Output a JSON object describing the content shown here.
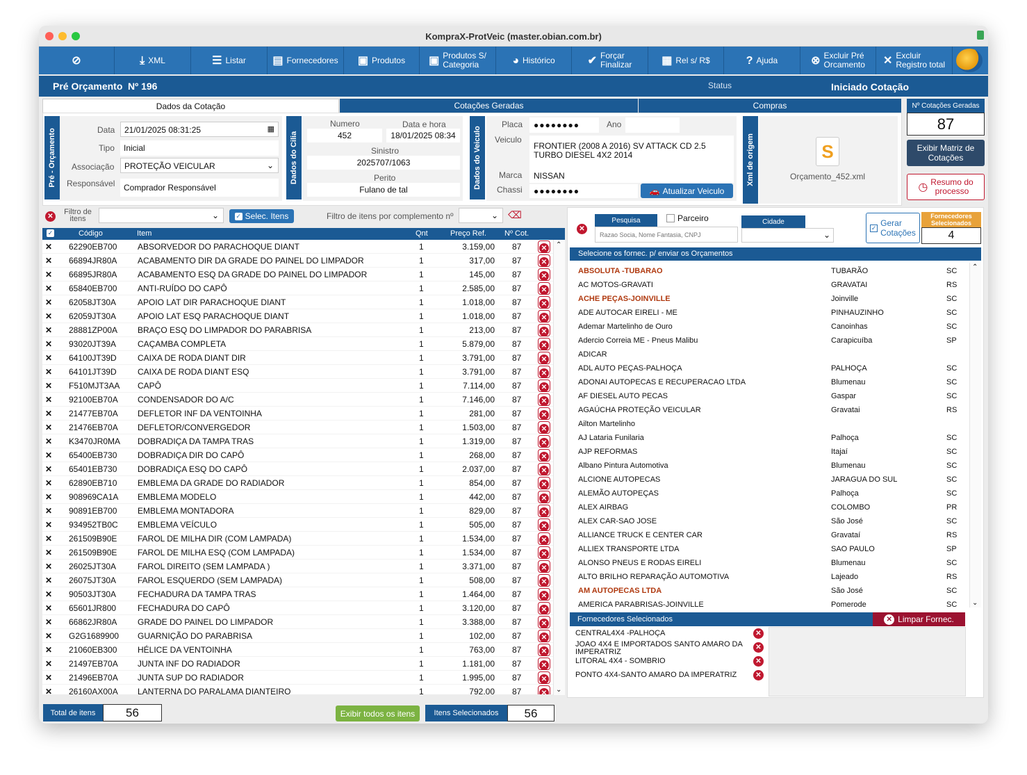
{
  "window": {
    "title": "KompraX-ProtVeic (master.obian.com.br)"
  },
  "toolbar": {
    "xml": "XML",
    "listar": "Listar",
    "fornecedores": "Fornecedores",
    "produtos": "Produtos",
    "produtos_cat_1": "Produtos S/",
    "produtos_cat_2": "Categoria",
    "historico": "Histórico",
    "forcar_1": "Forçar",
    "forcar_2": "Finalizar",
    "rel": "Rel s/ R$",
    "ajuda": "Ajuda",
    "excluir_pre_1": "Excluir Pré",
    "excluir_pre_2": "Orcamento",
    "excluir_reg_1": "Excluir",
    "excluir_reg_2": "Registro total"
  },
  "header": {
    "title": "Pré Orçamento",
    "number": "Nº 196",
    "status_label": "Status",
    "status_value": "Iniciado Cotação"
  },
  "tabs": {
    "dados": "Dados da Cotação",
    "cotacoes": "Cotações Geradas",
    "compras": "Compras"
  },
  "pre_orcamento": {
    "side": "Pré - Orçamento",
    "data_label": "Data",
    "data": "21/01/2025 08:31:25",
    "tipo_label": "Tipo",
    "tipo": "Inicial",
    "assoc_label": "Associação",
    "assoc": "PROTEÇÃO VEICULAR",
    "resp_label": "Responsável",
    "resp": "Comprador Responsável"
  },
  "cilia": {
    "side": "Dados do Cilia",
    "numero_label": "Numero",
    "numero": "452",
    "datahora_label": "Data e hora",
    "datahora": "18/01/2025 08:34",
    "sinistro_label": "Sinistro",
    "sinistro": "2025707/1063",
    "perito_label": "Perito",
    "perito": "Fulano de tal"
  },
  "veiculo": {
    "side": "Dados do Veiculo",
    "placa_label": "Placa",
    "placa": "●●●●●●●●",
    "ano_label": "Ano",
    "veiculo_label": "Veiculo",
    "veiculo_1": "FRONTIER (2008 A 2016) SV ATTACK CD 2.5",
    "veiculo_2": "TURBO DIESEL 4X2 2014",
    "marca_label": "Marca",
    "marca": "NISSAN",
    "chassi_label": "Chassi",
    "chassi": "●●●●●●●●",
    "atualizar": "Atualizar Veiculo"
  },
  "xml": {
    "side": "Xml de origem",
    "file": "Orçamento_452.xml"
  },
  "cotacoes": {
    "label": "Nº  Cotações Geradas",
    "count": "87",
    "matriz_1": "Exibir Matriz de",
    "matriz_2": "Cotações",
    "resumo_1": "Resumo do",
    "resumo_2": "processo"
  },
  "filter": {
    "filtro_1": "Filtro de",
    "filtro_2": "itens",
    "selec": "Selec. Itens",
    "complemento": "Filtro de itens por complemento nº"
  },
  "items_header": {
    "codigo": "Código",
    "item": "Item",
    "qnt": "Qnt",
    "preco": "Preço Ref.",
    "ncot": "Nº Cot."
  },
  "items": [
    [
      "62290EB700",
      "ABSORVEDOR DO PARACHOQUE DIANT",
      "1",
      "3.159,00",
      "87"
    ],
    [
      "66894JR80A",
      "ACABAMENTO DIR DA GRADE DO PAINEL DO LIMPADOR",
      "1",
      "317,00",
      "87"
    ],
    [
      "66895JR80A",
      "ACABAMENTO ESQ DA GRADE DO PAINEL DO LIMPADOR",
      "1",
      "145,00",
      "87"
    ],
    [
      "65840EB700",
      "ANTI-RUÍDO DO CAPÔ",
      "1",
      "2.585,00",
      "87"
    ],
    [
      "62058JT30A",
      "APOIO LAT DIR PARACHOQUE DIANT",
      "1",
      "1.018,00",
      "87"
    ],
    [
      "62059JT30A",
      "APOIO LAT ESQ PARACHOQUE DIANT",
      "1",
      "1.018,00",
      "87"
    ],
    [
      "28881ZP00A",
      "BRAÇO ESQ DO LIMPADOR DO PARABRISA",
      "1",
      "213,00",
      "87"
    ],
    [
      "93020JT39A",
      "CAÇAMBA COMPLETA",
      "1",
      "5.879,00",
      "87"
    ],
    [
      "64100JT39D",
      "CAIXA DE RODA DIANT DIR",
      "1",
      "3.791,00",
      "87"
    ],
    [
      "64101JT39D",
      "CAIXA DE RODA DIANT ESQ",
      "1",
      "3.791,00",
      "87"
    ],
    [
      "F510MJT3AA",
      "CAPÔ",
      "1",
      "7.114,00",
      "87"
    ],
    [
      "92100EB70A",
      "CONDENSADOR DO A/C",
      "1",
      "7.146,00",
      "87"
    ],
    [
      "21477EB70A",
      "DEFLETOR INF DA VENTOINHA",
      "1",
      "281,00",
      "87"
    ],
    [
      "21476EB70A",
      "DEFLETOR/CONVERGEDOR",
      "1",
      "1.503,00",
      "87"
    ],
    [
      "K3470JR0MA",
      "DOBRADIÇA DA TAMPA TRAS",
      "1",
      "1.319,00",
      "87"
    ],
    [
      "65400EB730",
      "DOBRADIÇA DIR DO CAPÔ",
      "1",
      "268,00",
      "87"
    ],
    [
      "65401EB730",
      "DOBRADIÇA ESQ DO CAPÔ",
      "1",
      "2.037,00",
      "87"
    ],
    [
      "62890EB710",
      "EMBLEMA DA GRADE DO RADIADOR",
      "1",
      "854,00",
      "87"
    ],
    [
      "908969CA1A",
      "EMBLEMA MODELO",
      "1",
      "442,00",
      "87"
    ],
    [
      "90891EB700",
      "EMBLEMA MONTADORA",
      "1",
      "829,00",
      "87"
    ],
    [
      "934952TB0C",
      "EMBLEMA VEÍCULO",
      "1",
      "505,00",
      "87"
    ],
    [
      "261509B90E",
      "FAROL DE MILHA DIR (COM LAMPADA)",
      "1",
      "1.534,00",
      "87"
    ],
    [
      "261509B90E",
      "FAROL DE MILHA ESQ (COM LAMPADA)",
      "1",
      "1.534,00",
      "87"
    ],
    [
      "26025JT30A",
      "FAROL DIREITO (SEM LAMPADA )",
      "1",
      "3.371,00",
      "87"
    ],
    [
      "26075JT30A",
      "FAROL ESQUERDO (SEM LAMPADA)",
      "1",
      "508,00",
      "87"
    ],
    [
      "90503JT30A",
      "FECHADURA DA TAMPA TRAS",
      "1",
      "1.464,00",
      "87"
    ],
    [
      "65601JR800",
      "FECHADURA DO CAPÔ",
      "1",
      "3.120,00",
      "87"
    ],
    [
      "66862JR80A",
      "GRADE DO PAINEL DO LIMPADOR",
      "1",
      "3.388,00",
      "87"
    ],
    [
      "G2G1689900",
      "GUARNIÇÃO DO PARABRISA",
      "1",
      "102,00",
      "87"
    ],
    [
      "21060EB300",
      "HÉLICE DA VENTOINHA",
      "1",
      "763,00",
      "87"
    ],
    [
      "21497EB70A",
      "JUNTA INF DO RADIADOR",
      "1",
      "1.181,00",
      "87"
    ],
    [
      "21496EB70A",
      "JUNTA SUP DO RADIADOR",
      "1",
      "1.995,00",
      "87"
    ],
    [
      "26160AX00A",
      "LANTERNA DO PARALAMA DIANTEIRO",
      "1",
      "792,00",
      "87"
    ]
  ],
  "footer": {
    "total_label": "Total de itens",
    "total": "56",
    "exibir": "Exibir todos os itens",
    "sel_label": "Itens Selecionados",
    "sel": "56"
  },
  "suppliers": {
    "pesquisa": "Pesquisa",
    "parceiro": "Parceiro",
    "placeholder": "Razao Socia, Nome Fantasia, CNPJ",
    "cidade": "Cidade",
    "gerar_1": "Gerar",
    "gerar_2": "Cotações",
    "selecionados_label": "Fornecedores Selecionados",
    "selecionados": "4",
    "list_title": "Selecione os fornec. p/ enviar os Orçamentos",
    "list": [
      [
        "ABSOLUTA -TUBARAO",
        "TUBARÃO",
        "SC",
        true
      ],
      [
        "AC MOTOS-GRAVATI",
        "GRAVATAI",
        "RS",
        false
      ],
      [
        "ACHE PEÇAS-JOINVILLE",
        "Joinville",
        "SC",
        true
      ],
      [
        "ADE AUTOCAR EIRELI - ME",
        "PINHAUZINHO",
        "SC",
        false
      ],
      [
        "Ademar Martelinho de Ouro",
        "Canoinhas",
        "SC",
        false
      ],
      [
        "Adercio Correia ME - Pneus Malibu",
        "Carapicuíba",
        "SP",
        false
      ],
      [
        "ADICAR",
        "",
        "",
        false
      ],
      [
        "ADL AUTO PEÇAS-PALHOÇA",
        "PALHOÇA",
        "SC",
        false
      ],
      [
        "ADONAI AUTOPECAS E RECUPERACAO LTDA",
        "Blumenau",
        "SC",
        false
      ],
      [
        "AF DIESEL  AUTO PECAS",
        "Gaspar",
        "SC",
        false
      ],
      [
        "AGAÚCHA PROTEÇÃO VEICULAR",
        "Gravatai",
        "RS",
        false
      ],
      [
        "Ailton Martelinho",
        "",
        "",
        false
      ],
      [
        "AJ Lataria Funilaria",
        "Palhoça",
        "SC",
        false
      ],
      [
        "AJP REFORMAS",
        "Itajaí",
        "SC",
        false
      ],
      [
        "Albano Pintura Automotiva",
        "Blumenau",
        "SC",
        false
      ],
      [
        "ALCIONE AUTOPECAS",
        "JARAGUA DO SUL",
        "SC",
        false
      ],
      [
        "ALEMÃO AUTOPEÇAS",
        "Palhoça",
        "SC",
        false
      ],
      [
        "ALEX AIRBAG",
        "COLOMBO",
        "PR",
        false
      ],
      [
        "ALEX CAR-SAO JOSE",
        "São José",
        "SC",
        false
      ],
      [
        "ALLIANCE TRUCK E CENTER CAR",
        "Gravataí",
        "RS",
        false
      ],
      [
        "ALLIEX TRANSPORTE LTDA",
        "SAO PAULO",
        "SP",
        false
      ],
      [
        "ALONSO PNEUS E RODAS EIRELI",
        "Blumenau",
        "SC",
        false
      ],
      [
        "ALTO BRILHO REPARAÇÃO AUTOMOTIVA",
        "Lajeado",
        "RS",
        false
      ],
      [
        "AM AUTOPECAS LTDA",
        "São José",
        "SC",
        true
      ],
      [
        "AMERICA PARABRISAS-JOINVILLE",
        "Pomerode",
        "SC",
        false
      ]
    ],
    "selected_title": "Fornecedores Selecionados",
    "limpar": "Limpar Fornec.",
    "selected": [
      "CENTRAL4X4 -PALHOÇA",
      "JOAO 4X4 E IMPORTADOS SANTO AMARO DA IMPERATRIZ",
      "LITORAL 4X4 - SOMBRIO",
      "PONTO 4X4-SANTO AMARO DA IMPERATRIZ"
    ]
  },
  "colors": {
    "primary": "#2b73b5",
    "dark": "#1b5a94",
    "accent_red": "#c0182f",
    "green": "#7cb342",
    "highlight": "#b03a10"
  }
}
